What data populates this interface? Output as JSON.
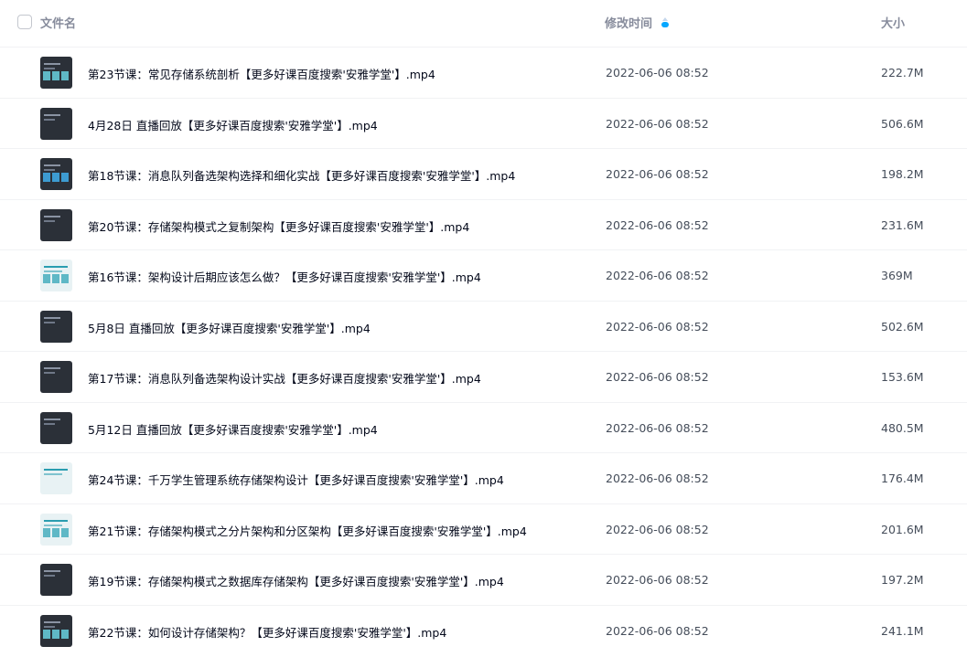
{
  "header": {
    "name_label": "文件名",
    "time_label": "修改时间",
    "size_label": "大小"
  },
  "files": [
    {
      "name": "第23节课：常见存储系统剖析【更多好课百度搜索'安雅学堂'】.mp4",
      "time": "2022-06-06 08:52",
      "size": "222.7M"
    },
    {
      "name": "4月28日 直播回放【更多好课百度搜索'安雅学堂'】.mp4",
      "time": "2022-06-06 08:52",
      "size": "506.6M"
    },
    {
      "name": "第18节课：消息队列备选架构选择和细化实战【更多好课百度搜索'安雅学堂'】.mp4",
      "time": "2022-06-06 08:52",
      "size": "198.2M"
    },
    {
      "name": "第20节课：存储架构模式之复制架构【更多好课百度搜索'安雅学堂'】.mp4",
      "time": "2022-06-06 08:52",
      "size": "231.6M"
    },
    {
      "name": "第16节课：架构设计后期应该怎么做？【更多好课百度搜索'安雅学堂'】.mp4",
      "time": "2022-06-06 08:52",
      "size": "369M"
    },
    {
      "name": "5月8日 直播回放【更多好课百度搜索'安雅学堂'】.mp4",
      "time": "2022-06-06 08:52",
      "size": "502.6M"
    },
    {
      "name": "第17节课：消息队列备选架构设计实战【更多好课百度搜索'安雅学堂'】.mp4",
      "time": "2022-06-06 08:52",
      "size": "153.6M"
    },
    {
      "name": "5月12日 直播回放【更多好课百度搜索'安雅学堂'】.mp4",
      "time": "2022-06-06 08:52",
      "size": "480.5M"
    },
    {
      "name": "第24节课：千万学生管理系统存储架构设计【更多好课百度搜索'安雅学堂'】.mp4",
      "time": "2022-06-06 08:52",
      "size": "176.4M"
    },
    {
      "name": "第21节课：存储架构模式之分片架构和分区架构【更多好课百度搜索'安雅学堂'】.mp4",
      "time": "2022-06-06 08:52",
      "size": "201.6M"
    },
    {
      "name": "第19节课：存储架构模式之数据库存储架构【更多好课百度搜索'安雅学堂'】.mp4",
      "time": "2022-06-06 08:52",
      "size": "197.2M"
    },
    {
      "name": "第22节课：如何设计存储架构？【更多好课百度搜索'安雅学堂'】.mp4",
      "time": "2022-06-06 08:52",
      "size": "241.1M"
    }
  ],
  "thumbnail_styles": [
    "mixed",
    "dark",
    "dark-blue",
    "dark",
    "light-blocks",
    "dark",
    "dark",
    "dark",
    "light",
    "light-blocks",
    "dark",
    "mixed"
  ]
}
